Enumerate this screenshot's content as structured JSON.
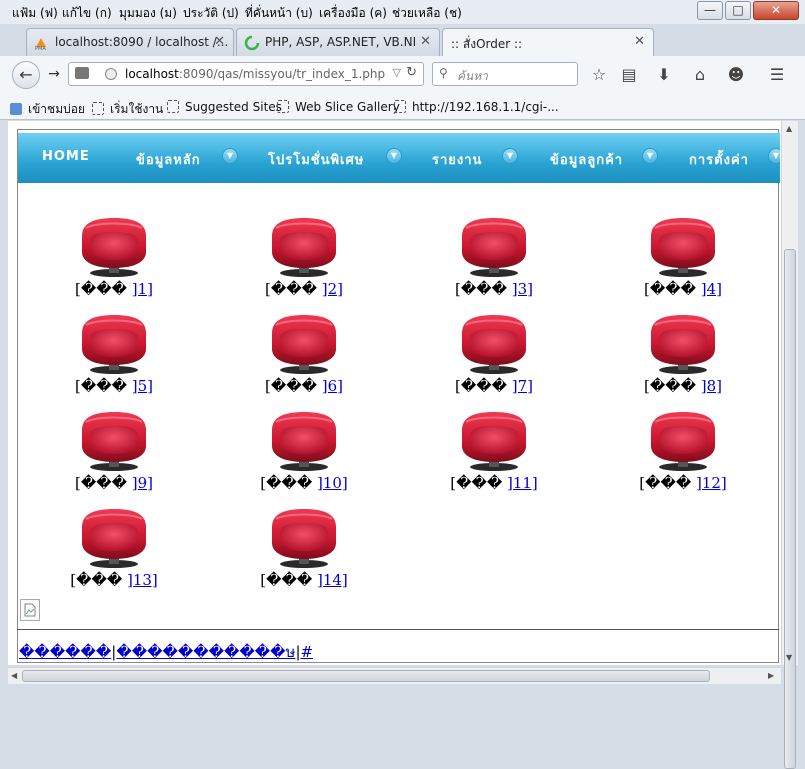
{
  "menubar": {
    "items": [
      "แฟ้ม (ฟ)",
      "แก้ไข (ก)",
      "มุมมอง (ม)",
      "ประวัติ (ป)",
      "ที่คั่นหน้า (บ)",
      "เครื่องมือ (ค)",
      "ช่วยเหลือ (ช)"
    ],
    "minimize": "—",
    "maximize": "□",
    "close": "✕"
  },
  "tabs": [
    {
      "title": "localhost:8090 / localhost /...",
      "icon": "phpmyadmin-icon",
      "close": "✕"
    },
    {
      "title": "PHP, ASP, ASP.NET, VB.NE...",
      "icon": "loading-icon",
      "close": "✕"
    },
    {
      "title": ":: สั่งOrder ::",
      "icon": "",
      "close": "✕"
    }
  ],
  "newtab": "+",
  "url": {
    "host": "localhost",
    "path": ":8090/qas/missyou/tr_index_1.php"
  },
  "search": {
    "placeholder": "ค้นหา"
  },
  "bookmarks": [
    "เข้าชมบ่อย",
    "เริ่มใช้งาน",
    "Suggested Sites",
    "Web Slice Gallery",
    "http://192.168.1.1/cgi-..."
  ],
  "nav_menu": [
    "HOME",
    "ข้อมูลหลัก",
    "โปรโมชั่นพิเศษ",
    "รายงาน",
    "ข้อมูลลูกค้า",
    "การตั้งค่า"
  ],
  "tables": [
    {
      "prefix": "[��� ",
      "num": "]1]"
    },
    {
      "prefix": "[��� ",
      "num": "]2]"
    },
    {
      "prefix": "[��� ",
      "num": "]3]"
    },
    {
      "prefix": "[��� ",
      "num": "]4]"
    },
    {
      "prefix": "[��� ",
      "num": "]5]"
    },
    {
      "prefix": "[��� ",
      "num": "]6]"
    },
    {
      "prefix": "[��� ",
      "num": "]7]"
    },
    {
      "prefix": "[��� ",
      "num": "]8]"
    },
    {
      "prefix": "[��� ",
      "num": "]9]"
    },
    {
      "prefix": "[��� ",
      "num": "]10]"
    },
    {
      "prefix": "[��� ",
      "num": "]11]"
    },
    {
      "prefix": "[��� ",
      "num": "]12]"
    },
    {
      "prefix": "[��� ",
      "num": "]13]"
    },
    {
      "prefix": "[��� ",
      "num": "]14]"
    }
  ],
  "footer": {
    "link1": "������",
    "sep1": "|",
    "link2": "�����������ษ",
    "sep2": "|",
    "link3": "#"
  },
  "colors": {
    "menu_blue": "#2aa4d4",
    "chair_red": "#d31c36",
    "link": "#0000cc"
  }
}
